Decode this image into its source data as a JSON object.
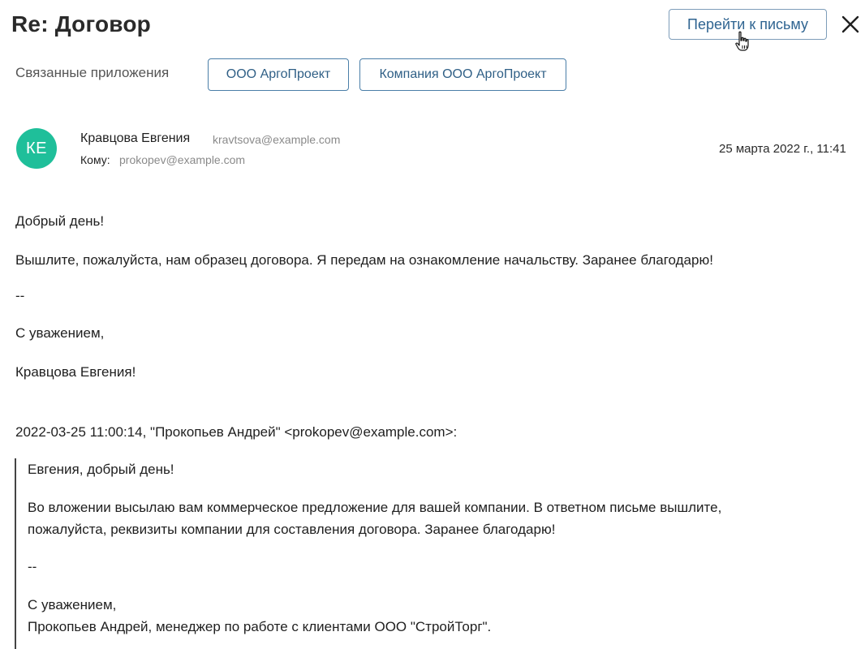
{
  "header": {
    "title": "Re: Договор",
    "goto_label": "Перейти к письму"
  },
  "related": {
    "label": "Связанные приложения",
    "items": [
      "ООО АргоПроект",
      "Компания ООО АргоПроект"
    ]
  },
  "message": {
    "avatar_initials": "КЕ",
    "avatar_color": "#1fbf9a",
    "sender_name": "Кравцова Евгения",
    "sender_email": "kravtsova@example.com",
    "to_label": "Кому:",
    "to_email": "prokopev@example.com",
    "date": "25 марта 2022 г., 11:41"
  },
  "body": {
    "greeting": "Добрый день!",
    "paragraph": "Вышлите, пожалуйста, нам образец договора. Я передам на ознакомление начальству. Заранее благодарю!",
    "separator": "--",
    "regards": "С уважением,",
    "signature": "Кравцова Евгения!"
  },
  "quote": {
    "header": "2022-03-25 11:00:14, \"Прокопьев Андрей\" <prokopev@example.com>:",
    "greeting": "Евгения, добрый день!",
    "paragraph_line1": "Во вложении высылаю вам коммерческое предложение для вашей компании. В ответном письме вышлите,",
    "paragraph_line2": "пожалуйста, реквизиты компании для составления договора. Заранее благодарю!",
    "separator": "--",
    "regards": "С уважением,",
    "signature": "Прокопьев Андрей, менеджер по работе с клиентами ООО \"СтройТорг\"."
  },
  "colors": {
    "accent": "#2f6491",
    "avatar": "#1fbf9a"
  }
}
